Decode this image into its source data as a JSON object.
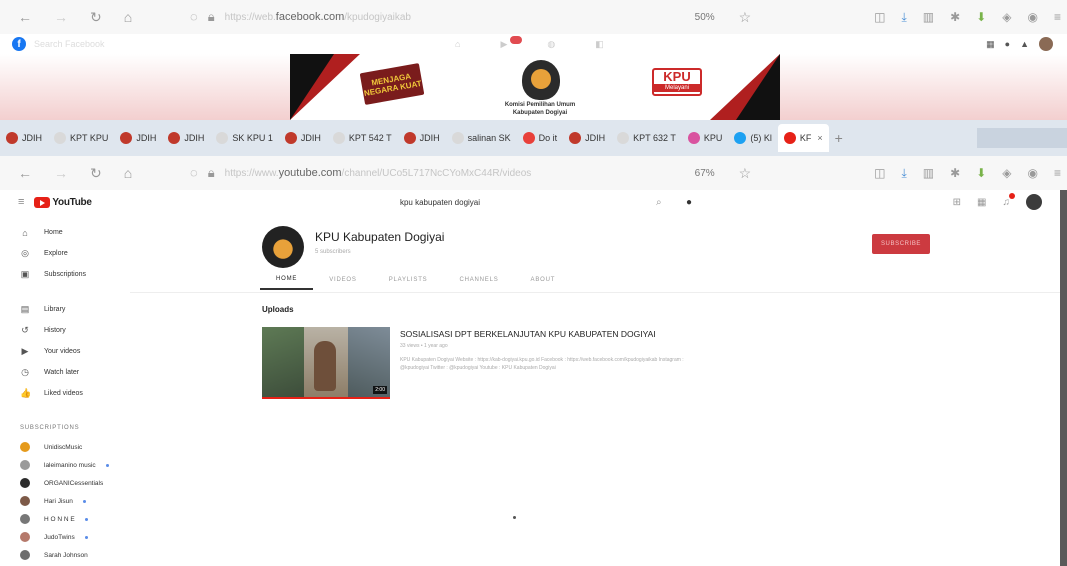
{
  "browser_top": {
    "url_prefix": "https://web.",
    "url_domain": "facebook.com",
    "url_path": "/kpudogiyaikab",
    "zoom": "50%"
  },
  "facebook": {
    "search_placeholder": "Search Facebook",
    "notification_count": "9"
  },
  "banner": {
    "motto": "MENJAGA NEGARA KUAT",
    "org_line1": "Komisi Pemilihan Umum",
    "org_line2": "Kabupaten Dogiyai",
    "kpu_word": "KPU",
    "kpu_sub": "Melayani"
  },
  "tabs": [
    {
      "label": "JDIH",
      "color": "#c0392b"
    },
    {
      "label": "KPT KPU",
      "color": "#d9d9d9"
    },
    {
      "label": "JDIH",
      "color": "#c0392b"
    },
    {
      "label": "JDIH",
      "color": "#c0392b"
    },
    {
      "label": "SK KPU 1",
      "color": "#d9d9d9"
    },
    {
      "label": "JDIH",
      "color": "#c0392b"
    },
    {
      "label": "KPT 542 T",
      "color": "#d9d9d9"
    },
    {
      "label": "JDIH",
      "color": "#c0392b"
    },
    {
      "label": "salinan SK",
      "color": "#d9d9d9"
    },
    {
      "label": "Do it",
      "color": "#e8403a"
    },
    {
      "label": "JDIH",
      "color": "#c0392b"
    },
    {
      "label": "KPT 632 T",
      "color": "#d9d9d9"
    },
    {
      "label": "KPU",
      "color": "#d9539f"
    },
    {
      "label": "(5) Kl",
      "color": "#1da1f2"
    },
    {
      "label": "KF",
      "color": "#e62117"
    }
  ],
  "browser_bottom": {
    "url_prefix": "https://www.",
    "url_domain": "youtube.com",
    "url_path": "/channel/UCo5L717NcCYoMxC44R/videos",
    "zoom": "67%"
  },
  "youtube": {
    "logo_text": "YouTube",
    "search_value": "kpu kabupaten dogiyai",
    "sidebar": [
      {
        "label": "Home",
        "icon": "home-icon",
        "glyph": "⌂"
      },
      {
        "label": "Explore",
        "icon": "compass-icon",
        "glyph": "◎"
      },
      {
        "label": "Subscriptions",
        "icon": "subscriptions-icon",
        "glyph": "▣"
      }
    ],
    "sidebar2": [
      {
        "label": "Library",
        "icon": "library-icon",
        "glyph": "▤"
      },
      {
        "label": "History",
        "icon": "history-icon",
        "glyph": "↺"
      },
      {
        "label": "Your videos",
        "icon": "your-videos-icon",
        "glyph": "▶"
      },
      {
        "label": "Watch later",
        "icon": "clock-icon",
        "glyph": "◷"
      },
      {
        "label": "Liked videos",
        "icon": "thumbs-up-icon",
        "glyph": "👍"
      }
    ],
    "subs_title": "SUBSCRIPTIONS",
    "subscriptions": [
      {
        "name": "UnidiscMusic",
        "color": "#e59a1c",
        "dot": false
      },
      {
        "name": "laleimanino music",
        "color": "#9a9a9a",
        "dot": true
      },
      {
        "name": "ORGANICessentials",
        "color": "#2c2c2c",
        "dot": false
      },
      {
        "name": "Hari Jisun",
        "color": "#7d5a48",
        "dot": true
      },
      {
        "name": "H O N N E",
        "color": "#777777",
        "dot": true
      },
      {
        "name": "JudoTwins",
        "color": "#b5796b",
        "dot": true
      },
      {
        "name": "Sarah Johnson",
        "color": "#6e6e6e",
        "dot": false
      }
    ],
    "channel": {
      "name": "KPU Kabupaten Dogiyai",
      "subscribers": "5 subscribers",
      "subscribe_label": "SUBSCRIBE",
      "tabs": [
        "HOME",
        "VIDEOS",
        "PLAYLISTS",
        "CHANNELS",
        "ABOUT"
      ],
      "active_tab": "HOME"
    },
    "uploads_title": "Uploads",
    "video": {
      "title": "SOSIALISASI DPT BERKELANJUTAN KPU KABUPATEN DOGIYAI",
      "meta": "33 views • 1 year ago",
      "description": "KPU Kabupaten Dogiyai Website : https://kab-dogiyai.kpu.go.id Facebook : https://web.facebook.com/kpudogiyaikab Instagram : @kpudogiyai Twitter : @kpudogiyai Youtube : KPU Kabupaten Dogiyai",
      "duration": "2:00"
    }
  }
}
